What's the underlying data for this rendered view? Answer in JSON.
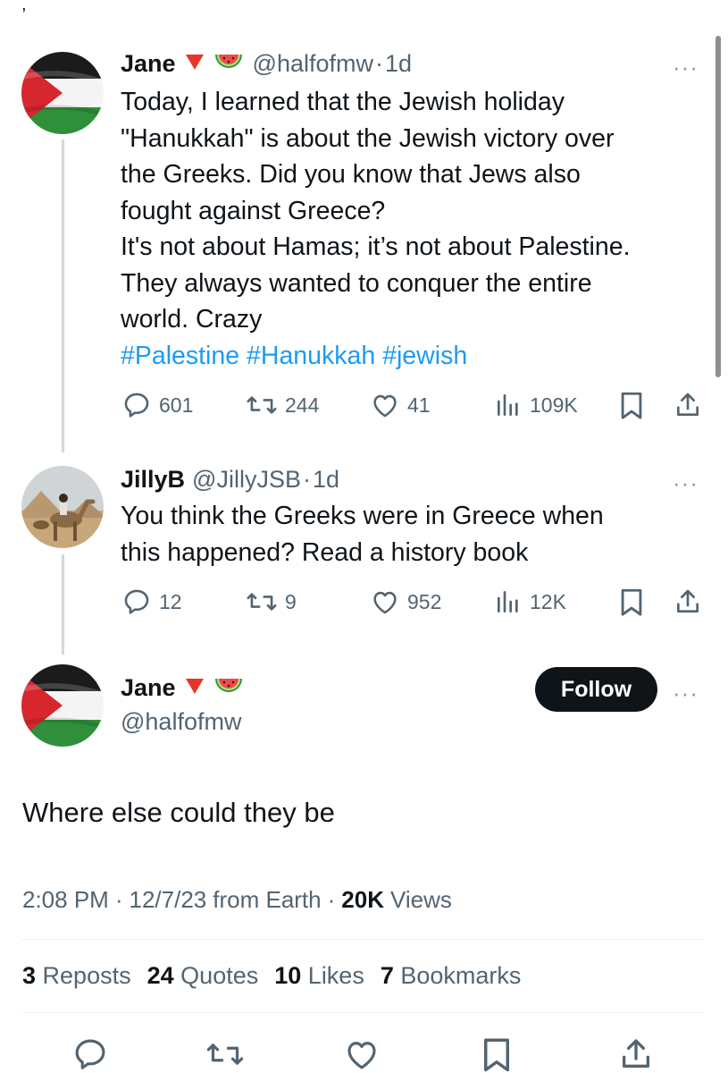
{
  "thread": {
    "tweet1": {
      "name": "Jane",
      "handle": "@halfofmw",
      "sep": "·",
      "time": "1d",
      "text_lines": [
        "Today, I learned that the Jewish holiday",
        "\"Hanukkah\" is about the Jewish victory over",
        "the Greeks. Did you know that Jews also",
        "fought against Greece?",
        "It's not about Hamas; it’s not about Palestine.",
        "They always wanted to conquer the entire",
        "world. Crazy"
      ],
      "hashtags": [
        "#Palestine",
        "#Hanukkah",
        "#jewish"
      ],
      "replies": "601",
      "reposts": "244",
      "likes": "41",
      "views": "109K",
      "more": "···"
    },
    "tweet2": {
      "name": "JillyB",
      "handle": "@JillyJSB",
      "sep": "·",
      "time": "1d",
      "text_lines": [
        "You think the Greeks were in Greece when",
        "this happened? Read a history book"
      ],
      "replies": "12",
      "reposts": "9",
      "likes": "952",
      "views": "12K",
      "more": "···"
    }
  },
  "main": {
    "name": "Jane",
    "handle": "@halfofmw",
    "follow_label": "Follow",
    "more": "···",
    "text": "Where else could they be",
    "meta": {
      "time": "2:08 PM",
      "sep1": "·",
      "date": "12/7/23",
      "source": "from Earth",
      "sep2": "·",
      "views_count": "20K",
      "views_label": "Views"
    },
    "stats": {
      "reposts_count": "3",
      "reposts_label": "Reposts",
      "quotes_count": "24",
      "quotes_label": "Quotes",
      "likes_count": "10",
      "likes_label": "Likes",
      "bookmarks_count": "7",
      "bookmarks_label": "Bookmarks"
    }
  },
  "colors": {
    "link": "#1d9bf0",
    "secondary_text": "#536471",
    "primary_text": "#0f1419",
    "follow_bg": "#0f1419"
  },
  "icons": [
    "reply-icon",
    "repost-icon",
    "like-icon",
    "views-icon",
    "bookmark-icon",
    "share-icon",
    "red-triangle-emoji",
    "watermelon-emoji",
    "palestine-flag-avatar",
    "camel-photo-avatar"
  ]
}
